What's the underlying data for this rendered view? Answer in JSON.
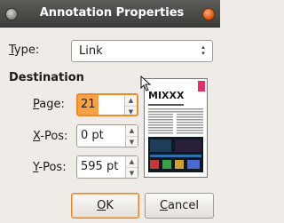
{
  "window": {
    "title": "Annotation Properties",
    "close_icon": "window-close-dot-icon",
    "maximize_icon": "window-maximize-dot-icon"
  },
  "type": {
    "label": "Type:",
    "mnemonic": "T",
    "label_rest": "ype:",
    "value": "Link"
  },
  "destination": {
    "heading": "Destination",
    "page": {
      "mnemonic": "P",
      "label_rest": "age:",
      "value": "21"
    },
    "xpos": {
      "mnemonic": "X",
      "label_rest": "-Pos:",
      "value": "0 pt"
    },
    "ypos": {
      "mnemonic": "Y",
      "label_rest": "-Pos:",
      "value": "595 pt"
    },
    "preview_title": "MIXXX"
  },
  "buttons": {
    "ok": {
      "mnemonic": "O",
      "label_rest": "K"
    },
    "cancel": {
      "mnemonic": "C",
      "label_rest": "ancel"
    }
  },
  "colors": {
    "accent": "#f08a28",
    "titlebar": "#4a4a48",
    "dialog_bg": "#efebe7"
  }
}
